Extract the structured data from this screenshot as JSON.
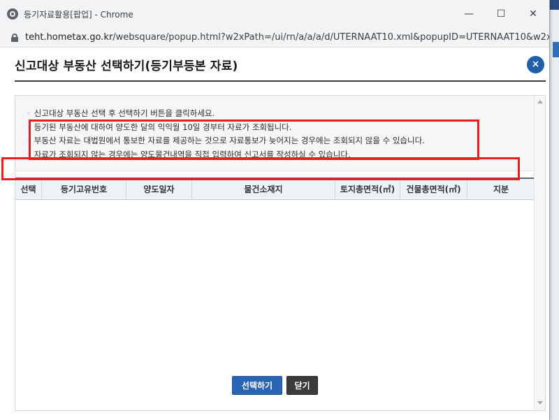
{
  "window": {
    "title": "등기자료활용[팝업] - Chrome",
    "url_host": "teht.hometax.go.kr",
    "url_path": "/websquare/popup.html?w2xPath=/ui/rn/a/a/a/d/UTERNAAT10.xml&popupID=UTERNAAT10&w2x..."
  },
  "header": {
    "title": "신고대상 부동산 선택하기(등기부등본 자료)",
    "close_label": "×"
  },
  "notices": [
    "신고대상 부동산 선택 후 선택하기 버튼을 클릭하세요.",
    "등기된 부동산에 대하여 양도한 달의 익익월 10일 경부터 자료가 조회됩니다.",
    "부동산 자료는 대법원에서 통보한 자료를 제공하는 것으로 자료통보가 늦어지는 경우에는 조회되지 않을 수 있습니다.",
    "자료가 조회되지 않는 경우에는 양도물건내역을 직접 입력하여 신고서를 작성하실 수 있습니다."
  ],
  "notice_bullet": "◦",
  "table": {
    "columns": [
      "선택",
      "등기고유번호",
      "양도일자",
      "물건소재지",
      "토지총면적(㎡)",
      "건물총면적(㎡)",
      "지분"
    ]
  },
  "buttons": {
    "select_label": "선택하기",
    "close_label": "닫기"
  },
  "colors": {
    "accent": "#2a65b5",
    "highlight": "#e81f1f"
  }
}
